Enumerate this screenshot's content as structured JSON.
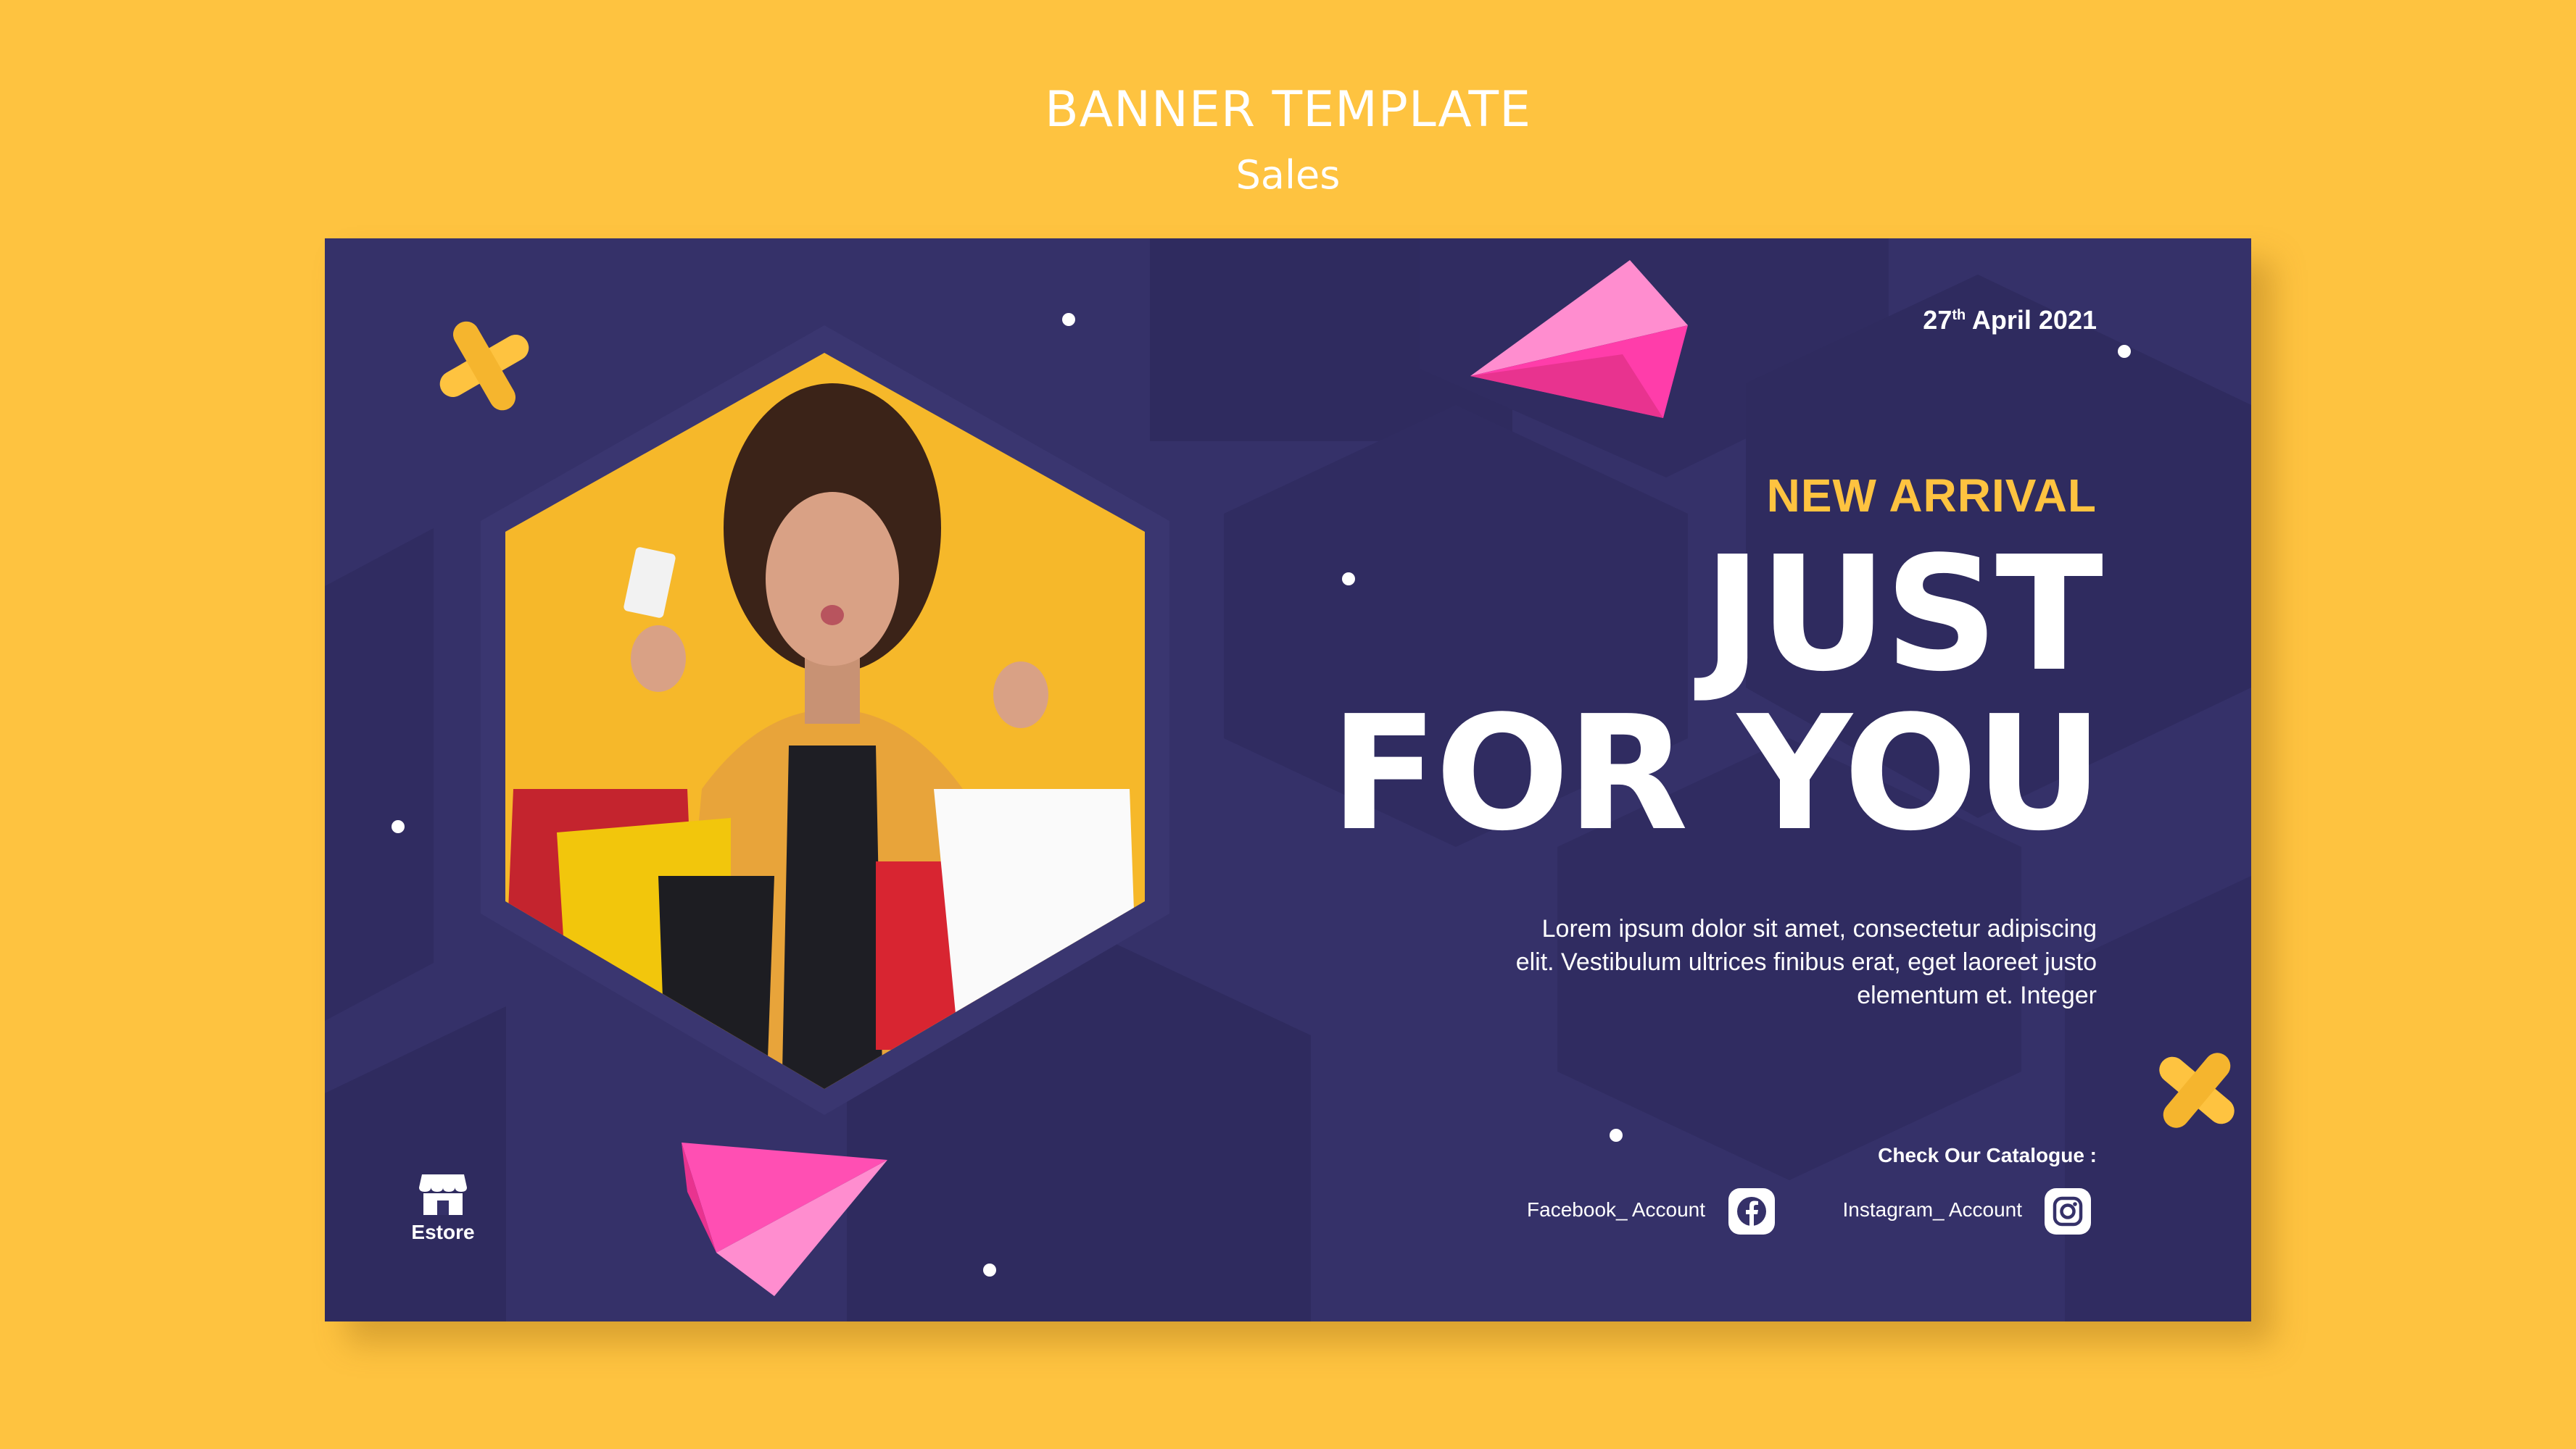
{
  "page": {
    "title": "BANNER TEMPLATE",
    "subtitle": "Sales"
  },
  "banner": {
    "date": {
      "day": "27",
      "suffix": "th",
      "rest": "April 2021"
    },
    "eyebrow": "NEW ARRIVAL",
    "headline": {
      "line1": "JUST",
      "line2": "FOR YOU"
    },
    "body": "Lorem ipsum dolor sit amet, consectetur adipiscing elit. Vestibulum ultrices finibus erat, eget laoreet justo elementum et. Integer",
    "catalogue_label": "Check Our Catalogue :",
    "social": {
      "facebook": "Facebook_ Account",
      "instagram": "Instagram_ Account"
    },
    "store": {
      "label": "Estore"
    }
  },
  "colors": {
    "page_background": "#FEC340",
    "banner_background": "#353169",
    "accent_yellow": "#FEC340",
    "accent_pink": "#FF4FB3",
    "text_white": "#FFFFFF"
  },
  "icons": {
    "store": "storefront-icon",
    "facebook": "facebook-icon",
    "instagram": "instagram-icon",
    "decor_cross": "plus-shape-icon",
    "decor_paper": "paper-plane-shape-icon"
  }
}
